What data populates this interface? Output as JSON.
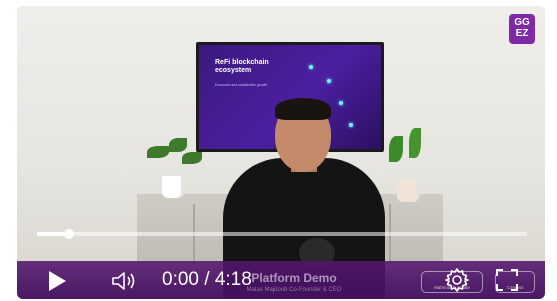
{
  "overlay": {
    "logo_text": "GG EZ"
  },
  "scene": {
    "tv_title": "ReFi blockchain ecosystem",
    "tv_subtitle": "Economic and sustainable growth"
  },
  "lower_third": {
    "title": "Platform Demo",
    "subtitle": "Matas Majdoub  Co-Founder & CEO"
  },
  "player": {
    "current_time": "0:00",
    "separator": " / ",
    "duration": "4:18",
    "progress": 0.065,
    "chip_left_label": "Mahmoudiur Date",
    "chip_right_label": "Connect"
  },
  "colors": {
    "accent": "#5a1a7c",
    "logo": "#7e2aa6"
  },
  "icons": {
    "play": "play-icon",
    "volume": "volume-icon",
    "settings": "gear-icon",
    "fullscreen": "fullscreen-icon"
  }
}
